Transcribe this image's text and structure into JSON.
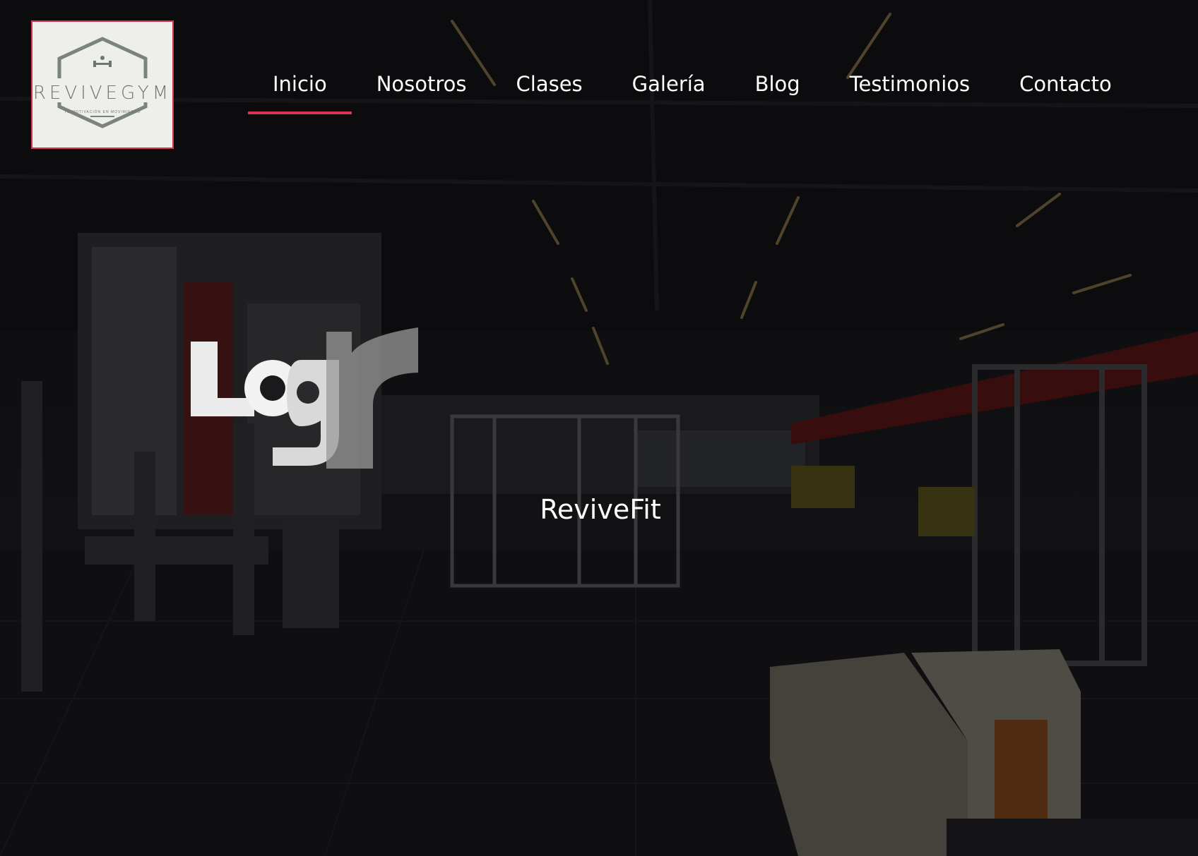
{
  "logo": {
    "wordmark": "REVIVEGYM",
    "tagline": "TU MOTIVACIÓN EN MOVIMIENTO",
    "border_color": "#d6374e"
  },
  "nav": {
    "items": [
      {
        "label": "Inicio",
        "active": true
      },
      {
        "label": "Nosotros",
        "active": false
      },
      {
        "label": "Clases",
        "active": false
      },
      {
        "label": "Galería",
        "active": false
      },
      {
        "label": "Blog",
        "active": false
      },
      {
        "label": "Testimonios",
        "active": false
      },
      {
        "label": "Contacto",
        "active": false
      }
    ],
    "active_color": "#e0344e"
  },
  "hero": {
    "title": "ReviveFit",
    "broken_image_text": "Logr",
    "background": "dark gym interior photo"
  }
}
